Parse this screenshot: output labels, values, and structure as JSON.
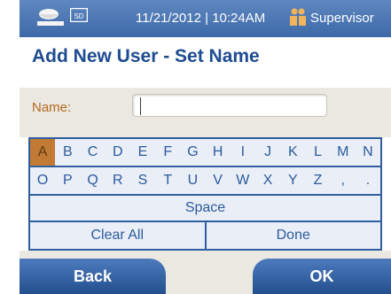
{
  "status_bar": {
    "datetime": "11/21/2012 | 10:24AM",
    "role": "Supervisor",
    "icons": [
      "meter-icon",
      "sd-card-icon",
      "supervisor-icon"
    ],
    "sd_label": "SD"
  },
  "page": {
    "title": "Add New User - Set Name"
  },
  "name_field": {
    "label": "Name:",
    "value": ""
  },
  "keyboard": {
    "row1": [
      "A",
      "B",
      "C",
      "D",
      "E",
      "F",
      "G",
      "H",
      "I",
      "J",
      "K",
      "L",
      "M",
      "N"
    ],
    "row2": [
      "O",
      "P",
      "Q",
      "R",
      "S",
      "T",
      "U",
      "V",
      "W",
      "X",
      "Y",
      "Z",
      ",",
      "."
    ],
    "space_label": "Space",
    "clear_label": "Clear All",
    "done_label": "Done",
    "selected_key": "A"
  },
  "buttons": {
    "back": "Back",
    "ok": "OK"
  },
  "colors": {
    "accent_blue": "#2c5b9c",
    "selected_key": "#c27a34",
    "label_orange": "#b5691f"
  }
}
